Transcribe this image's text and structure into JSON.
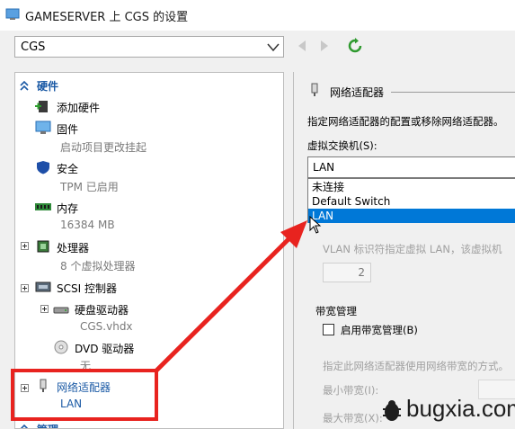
{
  "window": {
    "title": "GAMESERVER 上 CGS 的设置"
  },
  "vm_selector": {
    "value": "CGS"
  },
  "hardware_section": {
    "label": "硬件",
    "items": [
      {
        "label": "添加硬件",
        "sub": ""
      },
      {
        "label": "固件",
        "sub": "启动项目更改挂起"
      },
      {
        "label": "安全",
        "sub": "TPM 已启用"
      },
      {
        "label": "内存",
        "sub": "16384 MB"
      },
      {
        "label": "处理器",
        "sub": "8 个虚拟处理器"
      },
      {
        "label": "SCSI 控制器",
        "sub": ""
      },
      {
        "label": "硬盘驱动器",
        "sub": "CGS.vhdx"
      },
      {
        "label": "DVD 驱动器",
        "sub": "无"
      },
      {
        "label": "网络适配器",
        "sub": "LAN"
      }
    ]
  },
  "management_section": {
    "label": "管理"
  },
  "network_panel": {
    "heading": "网络适配器",
    "description": "指定网络适配器的配置或移除网络适配器。",
    "vswitch_label": "虚拟交换机(S):",
    "vswitch_value": "LAN",
    "vswitch_options": [
      "未连接",
      "Default Switch",
      "LAN"
    ],
    "vswitch_selected": "LAN",
    "vlan_text": "VLAN 标识符指定虚拟 LAN，该虚拟机",
    "vlan_value": "2",
    "bandwidth_heading": "带宽管理",
    "bandwidth_checkbox": "启用带宽管理(B)",
    "bandwidth_desc": "指定此网络适配器使用网络带宽的方式。",
    "min_bandwidth": "最小带宽(I):",
    "max_bandwidth": "最大带宽(X):"
  },
  "watermark": {
    "text": "bugxia.com"
  },
  "colors": {
    "accent": "#0078d7",
    "section_label": "#1b5aa5",
    "annotation": "#e8231f"
  }
}
